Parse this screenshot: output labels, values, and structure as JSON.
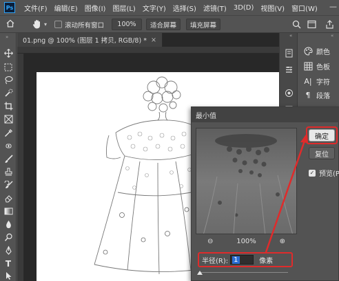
{
  "app": {
    "logo": "Ps"
  },
  "menu": [
    "文件(F)",
    "编辑(E)",
    "图像(I)",
    "图层(L)",
    "文字(Y)",
    "选择(S)",
    "滤镜(T)",
    "3D(D)",
    "视图(V)",
    "窗口(W)"
  ],
  "window_controls": {
    "minimize": "—"
  },
  "options": {
    "tool_icon": "hand-icon",
    "scroll_all_label": "滚动所有窗口",
    "zoom_value": "100%",
    "fit_screen": "适合屏幕",
    "fill_screen": "填充屏幕"
  },
  "document": {
    "tab_title": "01.png @ 100% (图层 1 拷贝, RGB/8) *",
    "close": "×"
  },
  "panels": {
    "items": [
      {
        "label": "颜色",
        "icon": "color-palette-icon"
      },
      {
        "label": "色板",
        "icon": "swatches-icon"
      },
      {
        "label": "字符",
        "icon": "character-icon"
      },
      {
        "label": "段落",
        "icon": "paragraph-icon"
      }
    ]
  },
  "dialog": {
    "title": "最小值",
    "ok_label": "确定",
    "reset_label": "复位",
    "preview_label": "预览(P)",
    "preview_checked": true,
    "zoom_out": "⊖",
    "zoom_level": "100%",
    "zoom_in": "⊕",
    "radius_label": "半径(R):",
    "radius_value": "1",
    "radius_unit": "像素"
  },
  "colors": {
    "highlight": "#e02b2b",
    "selection": "#2b6fd6"
  }
}
